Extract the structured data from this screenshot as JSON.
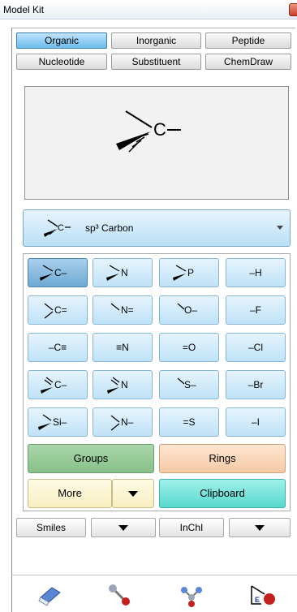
{
  "window": {
    "title": "Model Kit"
  },
  "tabs": [
    {
      "label": "Organic",
      "active": true
    },
    {
      "label": "Inorganic",
      "active": false
    },
    {
      "label": "Peptide",
      "active": false
    },
    {
      "label": "Nucleotide",
      "active": false
    },
    {
      "label": "Substituent",
      "active": false
    },
    {
      "label": "ChemDraw",
      "active": false
    }
  ],
  "preview": {
    "atom_symbol": "C"
  },
  "selector": {
    "label": "sp³ Carbon",
    "icon_symbol": "C"
  },
  "atoms": [
    {
      "text": "C–",
      "icon": "sp3-carbon-icon"
    },
    {
      "text": "N",
      "icon": "sp3-nitrogen-icon"
    },
    {
      "text": "P",
      "icon": "sp3-phosphorus-icon"
    },
    {
      "text": "–H",
      "icon": "hydrogen-icon"
    },
    {
      "text": "C=",
      "icon": "sp2-carbon-icon"
    },
    {
      "text": "N=",
      "icon": "sp2-nitrogen-icon"
    },
    {
      "text": "O–",
      "icon": "oxygen-icon"
    },
    {
      "text": "–F",
      "icon": "fluorine-icon"
    },
    {
      "text": "–C≡",
      "icon": "sp-carbon-icon"
    },
    {
      "text": "≡N",
      "icon": "sp-nitrogen-icon"
    },
    {
      "text": "=O",
      "icon": "carbonyl-oxygen-icon"
    },
    {
      "text": "–Cl",
      "icon": "chlorine-icon"
    },
    {
      "text": "C–",
      "icon": "trigonal-carbon-icon"
    },
    {
      "text": "N",
      "icon": "trigonal-nitrogen-icon"
    },
    {
      "text": "S–",
      "icon": "sulfur-icon"
    },
    {
      "text": "–Br",
      "icon": "bromine-icon"
    },
    {
      "text": "Si–",
      "icon": "silicon-icon"
    },
    {
      "text": "N–",
      "icon": "amide-nitrogen-icon"
    },
    {
      "text": "=S",
      "icon": "thione-sulfur-icon"
    },
    {
      "text": "–I",
      "icon": "iodine-icon"
    }
  ],
  "buttons": {
    "groups": "Groups",
    "rings": "Rings",
    "more": "More",
    "clipboard": "Clipboard",
    "smiles": "Smiles",
    "inchi": "InChI"
  },
  "toolbar": [
    {
      "icon": "eraser-icon"
    },
    {
      "icon": "bond-tool-icon"
    },
    {
      "icon": "fragment-tool-icon"
    },
    {
      "icon": "stereo-ez-icon"
    }
  ],
  "colors": {
    "tab_active": "#6fbcec",
    "atom_button": "#bfe2f7",
    "groups": "#86c189",
    "rings": "#f5c9a5",
    "more": "#f7eec0",
    "clipboard": "#58d9cf"
  }
}
